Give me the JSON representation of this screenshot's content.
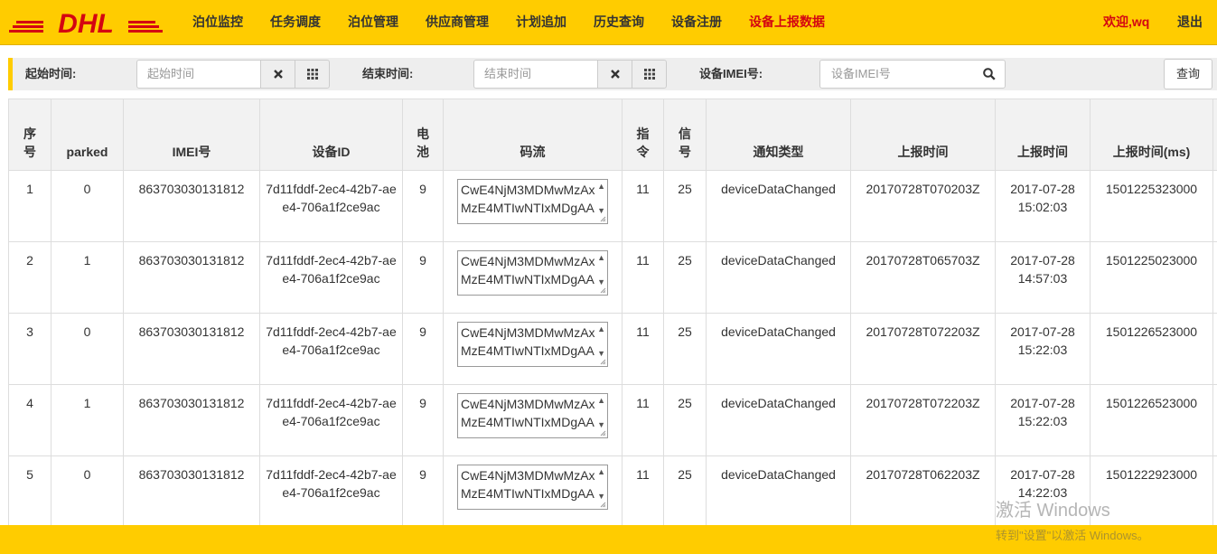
{
  "brand": {
    "logo_text": "DHL",
    "color": "#d40511",
    "accent": "#ffcc00"
  },
  "nav": {
    "items": [
      {
        "label": "泊位监控"
      },
      {
        "label": "任务调度"
      },
      {
        "label": "泊位管理"
      },
      {
        "label": "供应商管理"
      },
      {
        "label": "计划追加"
      },
      {
        "label": "历史查询"
      },
      {
        "label": "设备注册"
      },
      {
        "label": "设备上报数据",
        "active": true
      }
    ],
    "welcome": "欢迎,wq",
    "logout": "退出"
  },
  "filter": {
    "start_label": "起始时间:",
    "start_placeholder": "起始时间",
    "end_label": "结束时间:",
    "end_placeholder": "结束时间",
    "imei_label": "设备IMEI号:",
    "imei_placeholder": "设备IMEI号",
    "query": "查询"
  },
  "table": {
    "headers": [
      "序号",
      "parked",
      "IMEI号",
      "设备ID",
      "电池",
      "码流",
      "指令",
      "信号",
      "通知类型",
      "上报时间",
      "上报时间",
      "上报时间(ms)"
    ],
    "rows": [
      {
        "idx": "1",
        "parked": "0",
        "imei": "863703030131812",
        "device_id": "7d11fddf-2ec4-42b7-aee4-706a1f2ce9ac",
        "battery": "9",
        "code": "CwE4NjM3MDMwMzAxMzE4MTIwNTIxMDgAA",
        "cmd": "11",
        "signal": "25",
        "type": "deviceDataChanged",
        "time_raw": "20170728T070203Z",
        "time_date": "2017-07-28",
        "time_clock": "15:02:03",
        "time_ms": "1501225323000"
      },
      {
        "idx": "2",
        "parked": "1",
        "imei": "863703030131812",
        "device_id": "7d11fddf-2ec4-42b7-aee4-706a1f2ce9ac",
        "battery": "9",
        "code": "CwE4NjM3MDMwMzAxMzE4MTIwNTIxMDgAA",
        "cmd": "11",
        "signal": "25",
        "type": "deviceDataChanged",
        "time_raw": "20170728T065703Z",
        "time_date": "2017-07-28",
        "time_clock": "14:57:03",
        "time_ms": "1501225023000"
      },
      {
        "idx": "3",
        "parked": "0",
        "imei": "863703030131812",
        "device_id": "7d11fddf-2ec4-42b7-aee4-706a1f2ce9ac",
        "battery": "9",
        "code": "CwE4NjM3MDMwMzAxMzE4MTIwNTIxMDgAA",
        "cmd": "11",
        "signal": "25",
        "type": "deviceDataChanged",
        "time_raw": "20170728T072203Z",
        "time_date": "2017-07-28",
        "time_clock": "15:22:03",
        "time_ms": "1501226523000"
      },
      {
        "idx": "4",
        "parked": "1",
        "imei": "863703030131812",
        "device_id": "7d11fddf-2ec4-42b7-aee4-706a1f2ce9ac",
        "battery": "9",
        "code": "CwE4NjM3MDMwMzAxMzE4MTIwNTIxMDgAA",
        "cmd": "11",
        "signal": "25",
        "type": "deviceDataChanged",
        "time_raw": "20170728T072203Z",
        "time_date": "2017-07-28",
        "time_clock": "15:22:03",
        "time_ms": "1501226523000"
      },
      {
        "idx": "5",
        "parked": "0",
        "imei": "863703030131812",
        "device_id": "7d11fddf-2ec4-42b7-aee4-706a1f2ce9ac",
        "battery": "9",
        "code": "CwE4NjM3MDMwMzAxMzE4MTIwNTIxMDgAA",
        "cmd": "11",
        "signal": "25",
        "type": "deviceDataChanged",
        "time_raw": "20170728T062203Z",
        "time_date": "2017-07-28",
        "time_clock": "14:22:03",
        "time_ms": "1501222923000"
      }
    ]
  },
  "watermark": {
    "title": "激活 Windows",
    "subtitle": "转到\"设置\"以激活 Windows。"
  }
}
